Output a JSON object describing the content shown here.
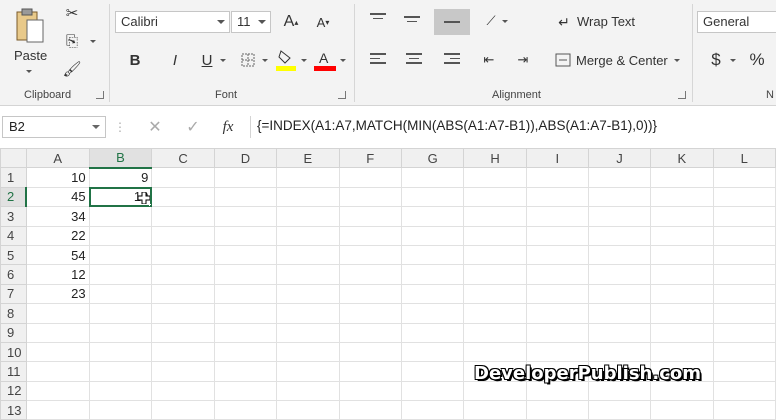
{
  "ribbon": {
    "clipboard": {
      "paste_label": "Paste",
      "group_label": "Clipboard"
    },
    "font": {
      "font_name": "Calibri",
      "font_size": "11",
      "bold": "B",
      "italic": "I",
      "underline": "U",
      "group_label": "Font",
      "highlight_color": "#ffff00",
      "font_color": "#ff0000"
    },
    "alignment": {
      "wrap_text": "Wrap Text",
      "merge_center": "Merge & Center",
      "group_label": "Alignment"
    },
    "number": {
      "format": "General",
      "currency": "$",
      "percent": "%",
      "group_label": "N"
    }
  },
  "formula_bar": {
    "name_box": "B2",
    "fx": "fx",
    "formula": "{=INDEX(A1:A7,MATCH(MIN(ABS(A1:A7-B1)),ABS(A1:A7-B1),0))}"
  },
  "sheet": {
    "columns": [
      "A",
      "B",
      "C",
      "D",
      "E",
      "F",
      "G",
      "H",
      "I",
      "J",
      "K",
      "L"
    ],
    "rows": [
      "1",
      "2",
      "3",
      "4",
      "5",
      "6",
      "7",
      "8",
      "9",
      "10",
      "11",
      "12",
      "13"
    ],
    "col_a": [
      "10",
      "45",
      "34",
      "22",
      "54",
      "12",
      "23"
    ],
    "b1": "9",
    "b2": "10",
    "active_cell": "B2"
  },
  "watermark": "DeveloperPublish.com",
  "colors": {
    "accent": "#217346"
  }
}
